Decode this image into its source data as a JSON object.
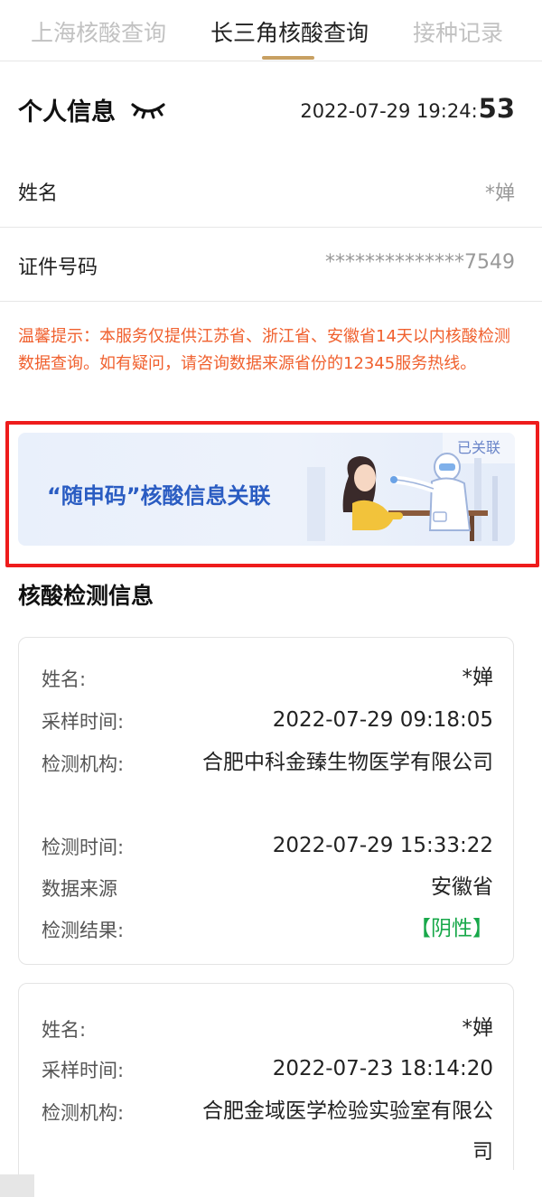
{
  "tabs": [
    {
      "label": "上海核酸查询",
      "active": false
    },
    {
      "label": "长三角核酸查询",
      "active": true
    },
    {
      "label": "接种记录",
      "active": false
    }
  ],
  "personal": {
    "title": "个人信息",
    "eye_icon": "eye-closed-icon",
    "timestamp_main": "2022-07-29 19:24:",
    "timestamp_seconds": "53",
    "name_label": "姓名",
    "name_value": "*婵",
    "id_label": "证件号码",
    "id_value": "**************7549"
  },
  "notice": "温馨提示：本服务仅提供江苏省、浙江省、安徽省14天以内核酸检测数据查询。如有疑问，请咨询数据来源省份的12345服务热线。",
  "banner": {
    "title": "“随申码”核酸信息关联",
    "badge": "已关联",
    "illustration": "nucleic-test-illustration"
  },
  "results": {
    "title": "核酸检测信息",
    "records": [
      {
        "name_label": "姓名:",
        "name": "*婵",
        "sample_label": "采样时间:",
        "sample_time": "2022-07-29 09:18:05",
        "org_label": "检测机构:",
        "org": "合肥中科金臻生物医学有限公司",
        "test_label": "检测时间:",
        "test_time": "2022-07-29 15:33:22",
        "source_label": "数据来源",
        "source": "安徽省",
        "result_label": "检测结果:",
        "result": "【阴性】"
      },
      {
        "name_label": "姓名:",
        "name": "*婵",
        "sample_label": "采样时间:",
        "sample_time": "2022-07-23 18:14:20",
        "org_label": "检测机构:",
        "org": "合肥金域医学检验实验室有限公司"
      }
    ]
  },
  "colors": {
    "accent": "#c8a062",
    "notice": "#f0602e",
    "highlight_border": "#ee1c1c",
    "banner_text": "#2a5cc2",
    "negative": "#18a84a"
  }
}
